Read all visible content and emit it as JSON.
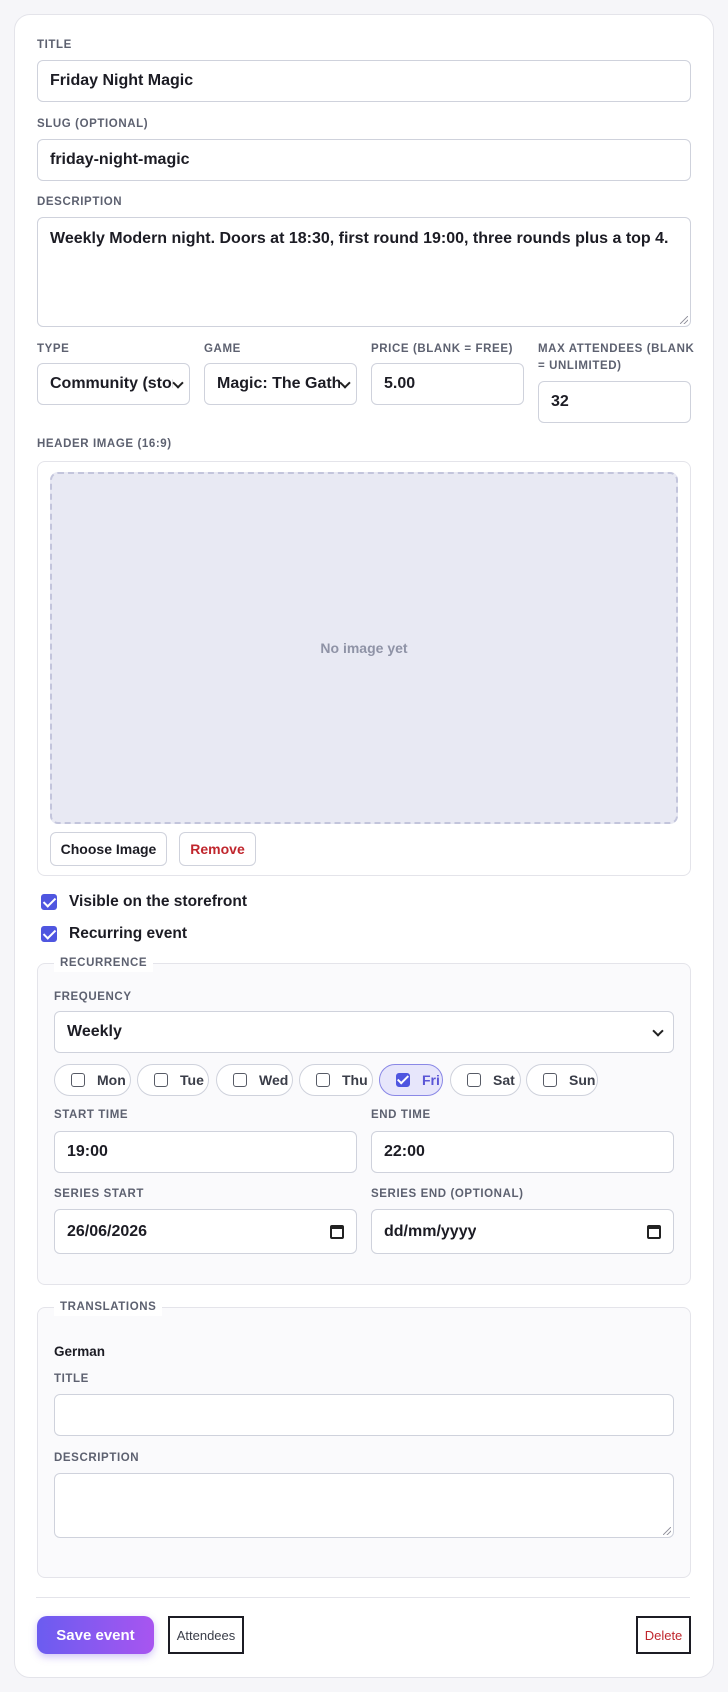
{
  "form": {
    "title": {
      "label": "TITLE",
      "value": "Friday Night Magic"
    },
    "slug": {
      "label": "SLUG (OPTIONAL)",
      "value": "friday-night-magic"
    },
    "description": {
      "label": "DESCRIPTION",
      "value": "Weekly Modern night. Doors at 18:30, first round 19:00, three rounds plus a top 4."
    },
    "type": {
      "label": "TYPE",
      "value": "Community (store)"
    },
    "game": {
      "label": "GAME",
      "value": "Magic: The Gathering"
    },
    "price": {
      "label": "PRICE (BLANK = FREE)",
      "value": "5.00"
    },
    "max_attendees": {
      "label_line1": "MAX ATTENDEES (BLANK",
      "label_line2": "= UNLIMITED)",
      "value": "32"
    }
  },
  "header_image": {
    "label": "HEADER IMAGE (16:9)",
    "placeholder": "No image yet",
    "choose_label": "Choose Image",
    "remove_label": "Remove"
  },
  "options": {
    "visible_label": "Visible on the storefront",
    "visible_checked": true,
    "recurring_label": "Recurring event",
    "recurring_checked": true
  },
  "recurrence": {
    "legend": "RECURRENCE",
    "frequency_label": "FREQUENCY",
    "frequency_value": "Weekly",
    "days": [
      {
        "label": "Mon",
        "checked": false
      },
      {
        "label": "Tue",
        "checked": false
      },
      {
        "label": "Wed",
        "checked": false
      },
      {
        "label": "Thu",
        "checked": false
      },
      {
        "label": "Fri",
        "checked": true
      },
      {
        "label": "Sat",
        "checked": false
      },
      {
        "label": "Sun",
        "checked": false
      }
    ],
    "start_time_label": "START TIME",
    "start_time": "19:00",
    "end_time_label": "END TIME",
    "end_time": "22:00",
    "series_start_label": "SERIES START",
    "series_start": "26/06/2026",
    "series_end_label": "SERIES END (OPTIONAL)",
    "series_end": "dd/mm/yyyy"
  },
  "translations": {
    "legend": "TRANSLATIONS",
    "language": "German",
    "title_label": "TITLE",
    "title_value": "",
    "description_label": "DESCRIPTION",
    "description_value": ""
  },
  "actions": {
    "save_label": "Save event",
    "attendees_label": "Attendees",
    "delete_label": "Delete"
  },
  "colors": {
    "accent": "#4f56e0",
    "save_gradient_start": "#6b5cf0",
    "save_gradient_end": "#a855f0",
    "danger": "#c0262d"
  }
}
